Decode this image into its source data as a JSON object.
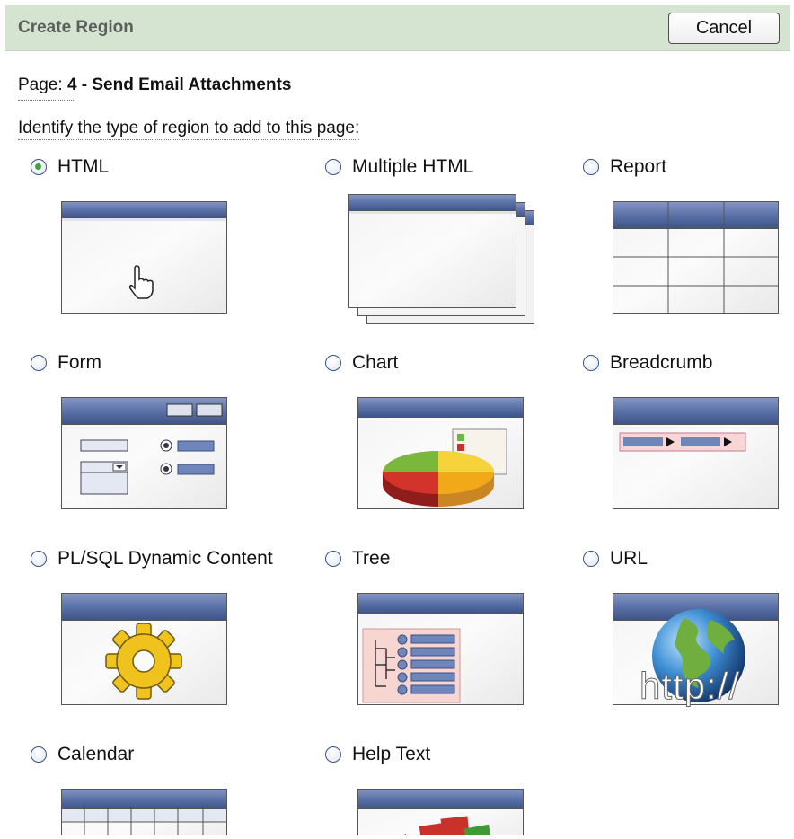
{
  "header": {
    "title": "Create Region",
    "cancel_label": "Cancel"
  },
  "page_info": {
    "label": "Page:",
    "value": "4 - Send Email Attachments"
  },
  "instruction": "Identify the type of region to add to this page:",
  "region_types": [
    {
      "label": "HTML",
      "selected": true,
      "icon": "html-region-icon"
    },
    {
      "label": "Multiple HTML",
      "selected": false,
      "icon": "multiple-html-region-icon"
    },
    {
      "label": "Report",
      "selected": false,
      "icon": "report-region-icon"
    },
    {
      "label": "Form",
      "selected": false,
      "icon": "form-region-icon"
    },
    {
      "label": "Chart",
      "selected": false,
      "icon": "chart-region-icon"
    },
    {
      "label": "Breadcrumb",
      "selected": false,
      "icon": "breadcrumb-region-icon"
    },
    {
      "label": "PL/SQL Dynamic Content",
      "selected": false,
      "icon": "plsql-gear-icon"
    },
    {
      "label": "Tree",
      "selected": false,
      "icon": "tree-region-icon"
    },
    {
      "label": "URL",
      "selected": false,
      "icon": "url-globe-icon"
    },
    {
      "label": "Calendar",
      "selected": false,
      "icon": "calendar-region-icon"
    },
    {
      "label": "Help Text",
      "selected": false,
      "icon": "help-books-icon"
    }
  ],
  "url_thumb_text": "http://",
  "colors": {
    "header_bg": "#d5e4d0",
    "title_bar": "#5b72a8",
    "radio_checked": "#3aa838"
  }
}
